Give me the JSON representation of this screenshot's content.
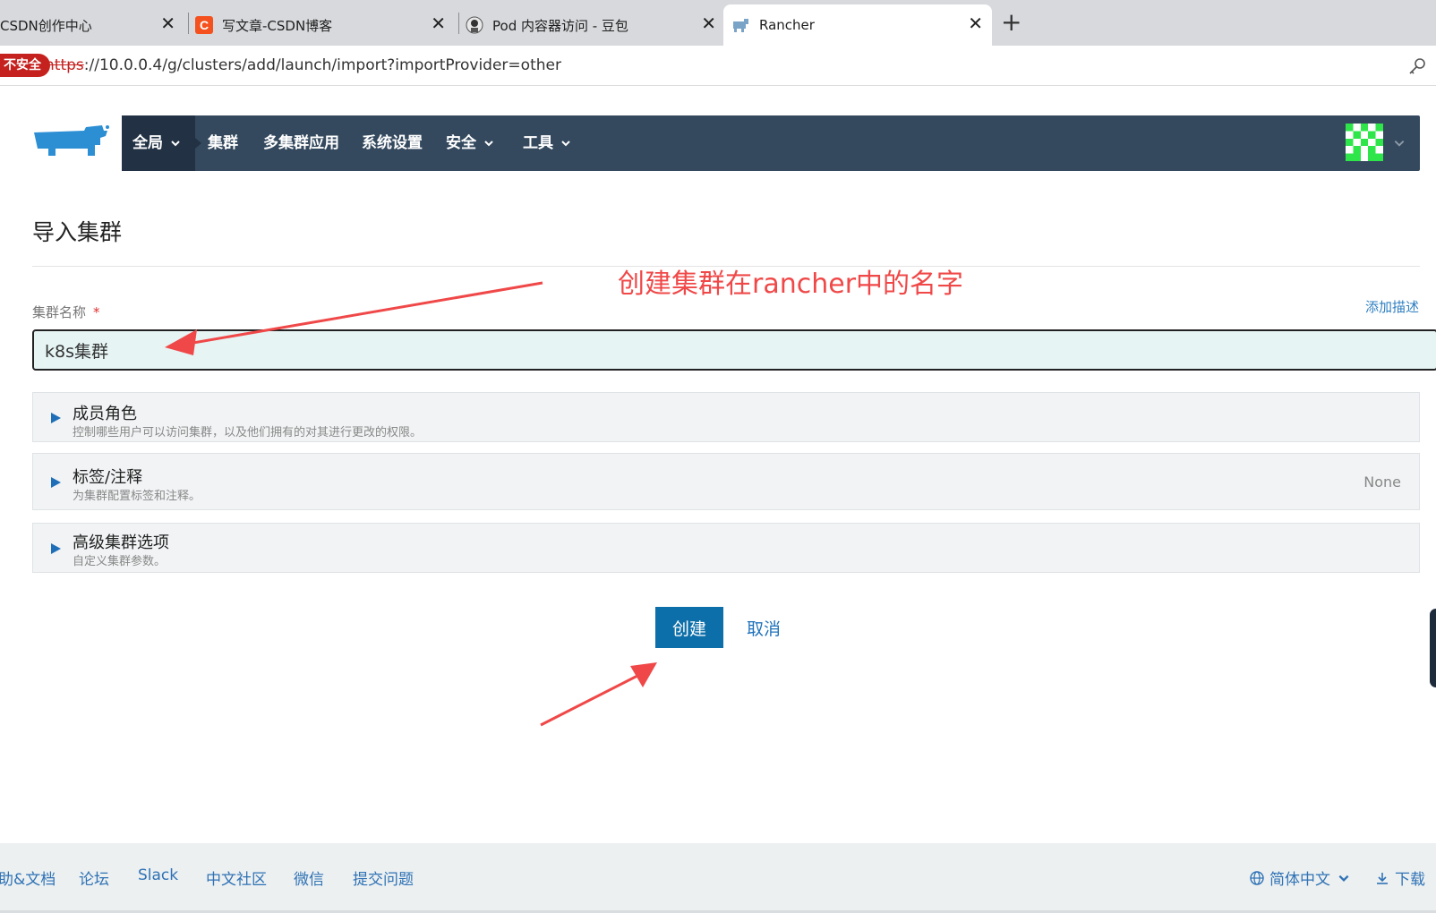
{
  "browser": {
    "tabs": [
      {
        "title": "CSDN创作中心",
        "favicon": "csdn-icon"
      },
      {
        "title": "写文章-CSDN博客",
        "favicon": "csdn-c-icon"
      },
      {
        "title": "Pod 内容器访问 - 豆包",
        "favicon": "doubao-icon"
      },
      {
        "title": "Rancher",
        "favicon": "rancher-icon"
      }
    ],
    "new_tab_icon": "plus-icon",
    "security_label": "不安全",
    "url_protocol": "https",
    "url_rest": "://10.0.0.4/g/clusters/add/launch/import?importProvider=other"
  },
  "nav": {
    "items": [
      {
        "label": "全局",
        "has_dropdown": true
      },
      {
        "label": "集群",
        "has_dropdown": false
      },
      {
        "label": "多集群应用",
        "has_dropdown": false
      },
      {
        "label": "系统设置",
        "has_dropdown": false
      },
      {
        "label": "安全",
        "has_dropdown": true
      },
      {
        "label": "工具",
        "has_dropdown": true
      }
    ]
  },
  "page": {
    "title": "导入集群",
    "annotation": "创建集群在rancher中的名字",
    "cluster_name_label": "集群名称",
    "required_mark": "*",
    "add_description": "添加描述",
    "cluster_name_value": "k8s集群"
  },
  "accordions": [
    {
      "title": "成员角色",
      "subtitle": "控制哪些用户可以访问集群，以及他们拥有的对其进行更改的权限。",
      "right": ""
    },
    {
      "title": "标签/注释",
      "subtitle": "为集群配置标签和注释。",
      "right": "None"
    },
    {
      "title": "高级集群选项",
      "subtitle": "自定义集群参数。",
      "right": ""
    }
  ],
  "actions": {
    "create": "创建",
    "cancel": "取消"
  },
  "footer": {
    "links": [
      "助&文档",
      "论坛",
      "Slack",
      "中文社区",
      "微信",
      "提交问题"
    ],
    "language": "简体中文",
    "download": "下载"
  },
  "colors": {
    "nav_bg": "#34495e",
    "nav_active": "#223244",
    "primary": "#0d6fa9",
    "annotation": "#f04848",
    "link": "#2f72b5"
  }
}
